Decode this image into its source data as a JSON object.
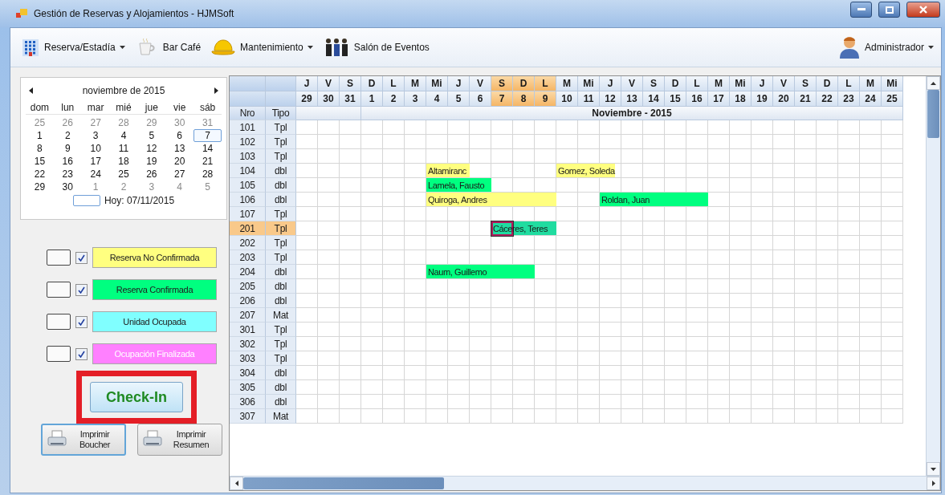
{
  "window": {
    "title": "Gestión de Reservas y Alojamientos - HJMSoft"
  },
  "toolbar": {
    "items": [
      {
        "label": "Reserva/Estadía",
        "kind": "building",
        "dropdown": true
      },
      {
        "label": "Bar Café",
        "kind": "cup",
        "dropdown": false
      },
      {
        "label": "Mantenimiento",
        "kind": "helmet",
        "dropdown": true
      },
      {
        "label": "Salón de Eventos",
        "kind": "people",
        "dropdown": false
      }
    ],
    "user": {
      "label": "Administrador",
      "dropdown": true
    }
  },
  "calendar": {
    "month": "noviembre de 2015",
    "weekdays": [
      "dom",
      "lun",
      "mar",
      "mié",
      "jue",
      "vie",
      "sáb"
    ],
    "weeks": [
      [
        {
          "day": "25",
          "muted": true,
          "selected": false
        },
        {
          "day": "26",
          "muted": true,
          "selected": false
        },
        {
          "day": "27",
          "muted": true,
          "selected": false
        },
        {
          "day": "28",
          "muted": true,
          "selected": false
        },
        {
          "day": "29",
          "muted": true,
          "selected": false
        },
        {
          "day": "30",
          "muted": true,
          "selected": false
        },
        {
          "day": "31",
          "muted": true,
          "selected": false
        }
      ],
      [
        {
          "day": "1",
          "muted": false,
          "selected": false
        },
        {
          "day": "2",
          "muted": false,
          "selected": false
        },
        {
          "day": "3",
          "muted": false,
          "selected": false
        },
        {
          "day": "4",
          "muted": false,
          "selected": false
        },
        {
          "day": "5",
          "muted": false,
          "selected": false
        },
        {
          "day": "6",
          "muted": false,
          "selected": false
        },
        {
          "day": "7",
          "muted": false,
          "selected": true
        }
      ],
      [
        {
          "day": "8",
          "muted": false,
          "selected": false
        },
        {
          "day": "9",
          "muted": false,
          "selected": false
        },
        {
          "day": "10",
          "muted": false,
          "selected": false
        },
        {
          "day": "11",
          "muted": false,
          "selected": false
        },
        {
          "day": "12",
          "muted": false,
          "selected": false
        },
        {
          "day": "13",
          "muted": false,
          "selected": false
        },
        {
          "day": "14",
          "muted": false,
          "selected": false
        }
      ],
      [
        {
          "day": "15",
          "muted": false,
          "selected": false
        },
        {
          "day": "16",
          "muted": false,
          "selected": false
        },
        {
          "day": "17",
          "muted": false,
          "selected": false
        },
        {
          "day": "18",
          "muted": false,
          "selected": false
        },
        {
          "day": "19",
          "muted": false,
          "selected": false
        },
        {
          "day": "20",
          "muted": false,
          "selected": false
        },
        {
          "day": "21",
          "muted": false,
          "selected": false
        }
      ],
      [
        {
          "day": "22",
          "muted": false,
          "selected": false
        },
        {
          "day": "23",
          "muted": false,
          "selected": false
        },
        {
          "day": "24",
          "muted": false,
          "selected": false
        },
        {
          "day": "25",
          "muted": false,
          "selected": false
        },
        {
          "day": "26",
          "muted": false,
          "selected": false
        },
        {
          "day": "27",
          "muted": false,
          "selected": false
        },
        {
          "day": "28",
          "muted": false,
          "selected": false
        }
      ],
      [
        {
          "day": "29",
          "muted": false,
          "selected": false
        },
        {
          "day": "30",
          "muted": false,
          "selected": false
        },
        {
          "day": "1",
          "muted": true,
          "selected": false
        },
        {
          "day": "2",
          "muted": true,
          "selected": false
        },
        {
          "day": "3",
          "muted": true,
          "selected": false
        },
        {
          "day": "4",
          "muted": true,
          "selected": false
        },
        {
          "day": "5",
          "muted": true,
          "selected": false
        }
      ]
    ],
    "today": "Hoy: 07/11/2015"
  },
  "legend": [
    {
      "label": "Reserva No Confirmada",
      "color": "#ffff80",
      "checked": true,
      "faded": false
    },
    {
      "label": "Reserva Confirmada",
      "color": "#00ff80",
      "checked": true,
      "faded": false
    },
    {
      "label": "Unidad Ocupada",
      "color": "#80ffff",
      "checked": true,
      "faded": false
    },
    {
      "label": "Ocupación Finalizada",
      "color": "#ff80ff",
      "checked": true,
      "faded": true
    }
  ],
  "checkin_button": {
    "label": "Check-In",
    "highlighted": true
  },
  "print_buttons": [
    {
      "label": "Imprimir Boucher",
      "focused": true
    },
    {
      "label": "Imprimir Resumen",
      "focused": false
    }
  ],
  "grid": {
    "columns": [
      "Nro",
      "Tipo"
    ],
    "month": "Noviembre - 2015",
    "days": [
      {
        "weekday": "J",
        "date": "29",
        "selected": false
      },
      {
        "weekday": "V",
        "date": "30",
        "selected": false
      },
      {
        "weekday": "S",
        "date": "31",
        "selected": false
      },
      {
        "weekday": "D",
        "date": "1",
        "selected": false
      },
      {
        "weekday": "L",
        "date": "2",
        "selected": false
      },
      {
        "weekday": "M",
        "date": "3",
        "selected": false
      },
      {
        "weekday": "Mi",
        "date": "4",
        "selected": false
      },
      {
        "weekday": "J",
        "date": "5",
        "selected": false
      },
      {
        "weekday": "V",
        "date": "6",
        "selected": false
      },
      {
        "weekday": "S",
        "date": "7",
        "selected": true
      },
      {
        "weekday": "D",
        "date": "8",
        "selected": true
      },
      {
        "weekday": "L",
        "date": "9",
        "selected": true
      },
      {
        "weekday": "M",
        "date": "10",
        "selected": false
      },
      {
        "weekday": "Mi",
        "date": "11",
        "selected": false
      },
      {
        "weekday": "J",
        "date": "12",
        "selected": false
      },
      {
        "weekday": "V",
        "date": "13",
        "selected": false
      },
      {
        "weekday": "S",
        "date": "14",
        "selected": false
      },
      {
        "weekday": "D",
        "date": "15",
        "selected": false
      },
      {
        "weekday": "L",
        "date": "16",
        "selected": false
      },
      {
        "weekday": "M",
        "date": "17",
        "selected": false
      },
      {
        "weekday": "Mi",
        "date": "18",
        "selected": false
      },
      {
        "weekday": "J",
        "date": "19",
        "selected": false
      },
      {
        "weekday": "V",
        "date": "20",
        "selected": false
      },
      {
        "weekday": "S",
        "date": "21",
        "selected": false
      },
      {
        "weekday": "D",
        "date": "22",
        "selected": false
      },
      {
        "weekday": "L",
        "date": "23",
        "selected": false
      },
      {
        "weekday": "M",
        "date": "24",
        "selected": false
      },
      {
        "weekday": "Mi",
        "date": "25",
        "selected": false
      }
    ],
    "rows": [
      {
        "nro": "101",
        "tipo": "Tpl",
        "selected": false
      },
      {
        "nro": "102",
        "tipo": "Tpl",
        "selected": false
      },
      {
        "nro": "103",
        "tipo": "Tpl",
        "selected": false
      },
      {
        "nro": "104",
        "tipo": "dbl",
        "selected": false,
        "cells": [
          null,
          null,
          null,
          null,
          null,
          null,
          {
            "guest": "Altamiranc",
            "color": "#ffff80"
          },
          {
            "color": "#ffff80"
          },
          null,
          null,
          null,
          null,
          {
            "guest": "Gomez, Soleda",
            "color": "#ffff80"
          },
          {
            "color": "#ffff80"
          }
        ]
      },
      {
        "nro": "105",
        "tipo": "dbl",
        "selected": false,
        "cells": [
          null,
          null,
          null,
          null,
          null,
          null,
          {
            "guest": "Lamela, Fausto",
            "color": "#00ff80"
          },
          {
            "color": "#00ff80"
          },
          {
            "color": "#00ff80"
          }
        ]
      },
      {
        "nro": "106",
        "tipo": "dbl",
        "selected": false,
        "cells": [
          null,
          null,
          null,
          null,
          null,
          null,
          {
            "guest": "Quiroga, Andres",
            "color": "#ffff80"
          },
          {
            "color": "#ffff80"
          },
          {
            "color": "#ffff80"
          },
          {
            "color": "#ffff80"
          },
          {
            "color": "#ffff80"
          },
          {
            "color": "#ffff80"
          },
          null,
          null,
          {
            "guest": "Roldan, Juan",
            "color": "#00ff80"
          },
          {
            "color": "#00ff80"
          },
          {
            "color": "#00ff80"
          },
          {
            "color": "#00ff80"
          },
          {
            "color": "#00ff80"
          }
        ]
      },
      {
        "nro": "107",
        "tipo": "Tpl",
        "selected": false
      },
      {
        "nro": "201",
        "tipo": "Tpl",
        "selected": true,
        "cells": [
          null,
          null,
          null,
          null,
          null,
          null,
          null,
          null,
          null,
          {
            "guest": "Cáceres, Teres",
            "color": "#20dca0"
          },
          {
            "color": "#20dca0"
          },
          {
            "color": "#20dca0"
          }
        ]
      },
      {
        "nro": "202",
        "tipo": "Tpl",
        "selected": false
      },
      {
        "nro": "203",
        "tipo": "Tpl",
        "selected": false
      },
      {
        "nro": "204",
        "tipo": "dbl",
        "selected": false,
        "cells": [
          null,
          null,
          null,
          null,
          null,
          null,
          {
            "guest": "Naum, Guillemo",
            "color": "#00ff80"
          },
          {
            "color": "#00ff80"
          },
          {
            "color": "#00ff80"
          },
          {
            "color": "#00ff80"
          },
          {
            "color": "#00ff80"
          }
        ]
      },
      {
        "nro": "205",
        "tipo": "dbl",
        "selected": false
      },
      {
        "nro": "206",
        "tipo": "dbl",
        "selected": false
      },
      {
        "nro": "207",
        "tipo": "Mat",
        "selected": false
      },
      {
        "nro": "301",
        "tipo": "Tpl",
        "selected": false
      },
      {
        "nro": "302",
        "tipo": "Tpl",
        "selected": false
      },
      {
        "nro": "303",
        "tipo": "Tpl",
        "selected": false
      },
      {
        "nro": "304",
        "tipo": "dbl",
        "selected": false
      },
      {
        "nro": "305",
        "tipo": "dbl",
        "selected": false
      },
      {
        "nro": "306",
        "tipo": "dbl",
        "selected": false
      },
      {
        "nro": "307",
        "tipo": "Mat",
        "selected": false
      }
    ]
  }
}
